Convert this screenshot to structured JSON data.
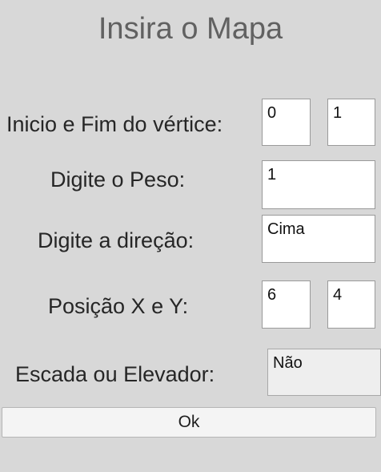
{
  "title": "Insira o Mapa",
  "form": {
    "vertex": {
      "label": "Inicio e Fim do vértice:",
      "start": "0",
      "end": "1"
    },
    "weight": {
      "label": "Digite o Peso:",
      "value": "1"
    },
    "direction": {
      "label": "Digite a direção:",
      "value": "Cima"
    },
    "position": {
      "label": "Posição X e Y:",
      "x": "6",
      "y": "4"
    },
    "floor_type": {
      "label": "Escada ou Elevador:",
      "value": "Não"
    }
  },
  "ok_label": "Ok"
}
